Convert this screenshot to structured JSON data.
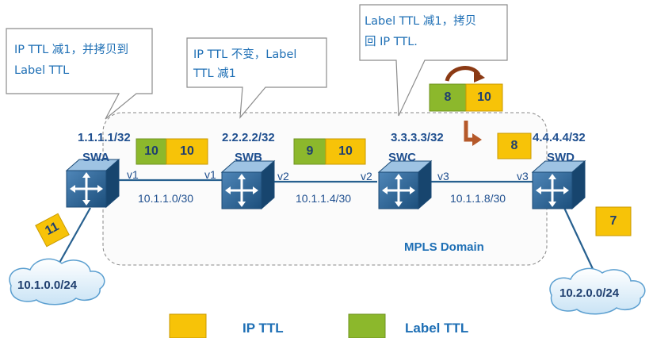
{
  "callouts": {
    "swa": {
      "line1": "IP TTL 减1，并拷贝到",
      "line2": "Label TTL"
    },
    "swb": {
      "line1": "IP TTL 不变，Label",
      "line2": "TTL 减1"
    },
    "swc": {
      "line1": "Label TTL 减1，拷贝",
      "line2": "回 IP TTL."
    }
  },
  "nodes": {
    "swa": {
      "name": "SWA",
      "address": "1.1.1.1/32"
    },
    "swb": {
      "name": "SWB",
      "address": "2.2.2.2/32"
    },
    "swc": {
      "name": "SWC",
      "address": "3.3.3.3/32"
    },
    "swd": {
      "name": "SWD",
      "address": "4.4.4.4/32"
    }
  },
  "ports": {
    "swa_right": "v1",
    "swb_left": "v1",
    "swb_right": "v2",
    "swc_left": "v2",
    "swc_right": "v3",
    "swd_left": "v3"
  },
  "links": {
    "ab": "10.1.1.0/30",
    "bc": "10.1.1.4/30",
    "cd": "10.1.1.8/30"
  },
  "domain_label": "MPLS Domain",
  "clouds": {
    "left": "10.1.0.0/24",
    "right": "10.2.0.0/24"
  },
  "ttl_boxes": {
    "ingress_ip": "11",
    "ab_label": "10",
    "ab_ip": "10",
    "bc_label": "9",
    "bc_ip": "10",
    "swc_label": "8",
    "swc_ip": "10",
    "swc_out_ip": "8",
    "egress_ip": "7"
  },
  "legend": {
    "ip_ttl": "IP TTL",
    "label_ttl": "Label TTL"
  },
  "colors": {
    "ip_ttl": "#f7c308",
    "label_ttl": "#8cb82c",
    "text_blue": "#1e6fb5",
    "arrow_brown": "#a0521e",
    "switch_blue": "#1f5c8a"
  }
}
